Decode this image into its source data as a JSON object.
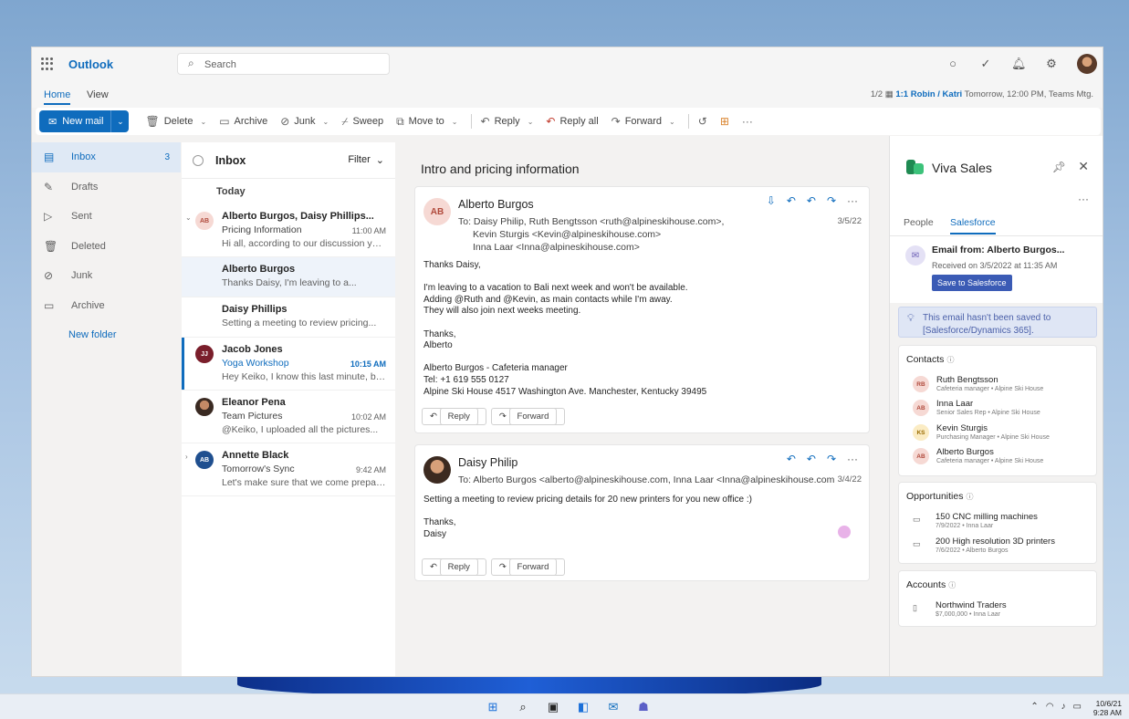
{
  "app": {
    "title": "Outlook",
    "search_placeholder": "Search"
  },
  "tabs": [
    "Home",
    "View"
  ],
  "meeting": {
    "pager": "1/2",
    "title": "1:1 Robin / Katri",
    "detail": "Tomorrow, 12:00 PM, Teams Mtg."
  },
  "toolbar": {
    "new_mail": "New mail",
    "delete": "Delete",
    "archive": "Archive",
    "junk": "Junk",
    "sweep": "Sweep",
    "move_to": "Move to",
    "reply": "Reply",
    "reply_all": "Reply all",
    "forward": "Forward"
  },
  "nav": {
    "items": [
      {
        "label": "Inbox",
        "count": "3",
        "icon": "inbox-icon"
      },
      {
        "label": "Drafts",
        "count": "",
        "icon": "drafts-icon"
      },
      {
        "label": "Sent",
        "count": "",
        "icon": "sent-icon"
      },
      {
        "label": "Deleted",
        "count": "",
        "icon": "trash-icon"
      },
      {
        "label": "Junk",
        "count": "",
        "icon": "junk-icon"
      },
      {
        "label": "Archive",
        "count": "",
        "icon": "archive-icon"
      }
    ],
    "new_folder": "New folder"
  },
  "list": {
    "title": "Inbox",
    "filter": "Filter",
    "group": "Today",
    "messages": [
      {
        "initials": "AB",
        "from": "Alberto Burgos, Daisy Phillips...",
        "subject": "Pricing Information",
        "time": "11:00 AM",
        "preview": "Hi all, according to our discussion yeterday"
      },
      {
        "initials": "",
        "from": "Alberto Burgos",
        "subject": "",
        "time": "",
        "preview": "Thanks Daisy, I'm leaving to a..."
      },
      {
        "initials": "",
        "from": "Daisy Phillips",
        "subject": "",
        "time": "",
        "preview": "Setting a meeting to review pricing..."
      },
      {
        "initials": "JJ",
        "from": "Jacob Jones",
        "subject": "Yoga Workshop",
        "time": "10:15 AM",
        "preview": "Hey Keiko, I know this last minute, but..."
      },
      {
        "initials": "",
        "from": "Eleanor Pena",
        "subject": "Team Pictures",
        "time": "10:02 AM",
        "preview": "@Keiko, I uploaded all the pictures..."
      },
      {
        "initials": "AB",
        "from": "Annette Black",
        "subject": "Tomorrow's Sync",
        "time": "9:42 AM",
        "preview": "Let's make sure that we come prepared..."
      }
    ]
  },
  "reading": {
    "subject": "Intro and pricing information",
    "mail1": {
      "initials": "AB",
      "sender": "Alberto Burgos",
      "to_line1": "To: Daisy Philip, Ruth Bengtsson <ruth@alpineskihouse.com>,",
      "to_line2": "Kevin Sturgis <Kevin@alpineskihouse.com>",
      "to_line3": "Inna Laar <Inna@alpineskihouse.com>",
      "date": "3/5/22",
      "body": [
        "Thanks Daisy,",
        "",
        "I'm leaving to a vacation to Bali next week and won't be available.",
        "Adding @Ruth and @Kevin, as main contacts while I'm away.",
        "They will also join next weeks meeting.",
        "",
        "Thanks,",
        "Alberto",
        "",
        "Alberto Burgos - Cafeteria manager",
        "Tel: +1 619 555 0127",
        "Alpine Ski House 4517 Washington Ave. Manchester, Kentucky 39495"
      ],
      "reply": "Reply",
      "forward": "Forward"
    },
    "mail2": {
      "sender": "Daisy Philip",
      "to_line1": "To: Alberto Burgos <alberto@alpineskihouse.com, Inna Laar <Inna@alpineskihouse.com",
      "date": "3/4/22",
      "body": [
        "Setting a meeting to review pricing details for 20 new printers for you new office :)",
        "",
        "Thanks,",
        "Daisy"
      ],
      "reply": "Reply",
      "forward": "Forward"
    }
  },
  "viva": {
    "title": "Viva Sales",
    "tabs": [
      "People",
      "Salesforce"
    ],
    "email_from": "Email from: Alberto Burgos...",
    "received": "Received on 3/5/2022 at 11:35 AM",
    "save_button": "Save to Salesforce",
    "notice": "This email hasn't been saved to [Salesforce/Dynamics 365].",
    "contacts_header": "Contacts",
    "contacts": [
      {
        "initials": "RB",
        "name": "Ruth Bengtsson",
        "role": "Cafeteria manager • Alpine Ski House",
        "bg": "#f6d9d4",
        "fg": "#b04a3c"
      },
      {
        "initials": "AB",
        "name": "Inna Laar",
        "role": "Senior Sales Rep • Alpine Ski House",
        "bg": "#f6d9d4",
        "fg": "#b04a3c"
      },
      {
        "initials": "KS",
        "name": "Kevin  Sturgis",
        "role": "Purchasing Manager • Alpine Ski House",
        "bg": "#fbecc4",
        "fg": "#9a6b00"
      },
      {
        "initials": "AB",
        "name": "Alberto Burgos",
        "role": "Cafeteria manager • Alpine Ski House",
        "bg": "#f6d9d4",
        "fg": "#b04a3c"
      }
    ],
    "opportunities_header": "Opportunities",
    "opportunities": [
      {
        "name": "150 CNC milling machines",
        "sub": "7/9/2022 • Inna Laar"
      },
      {
        "name": "200 High resolution 3D printers",
        "sub": "7/6/2022 • Alberto Burgos"
      }
    ],
    "accounts_header": "Accounts",
    "accounts": [
      {
        "name": "Northwind Traders",
        "sub": "$7,000,000 • Inna Laar"
      }
    ]
  },
  "taskbar": {
    "date": "10/6/21",
    "time": "9:28 AM"
  }
}
